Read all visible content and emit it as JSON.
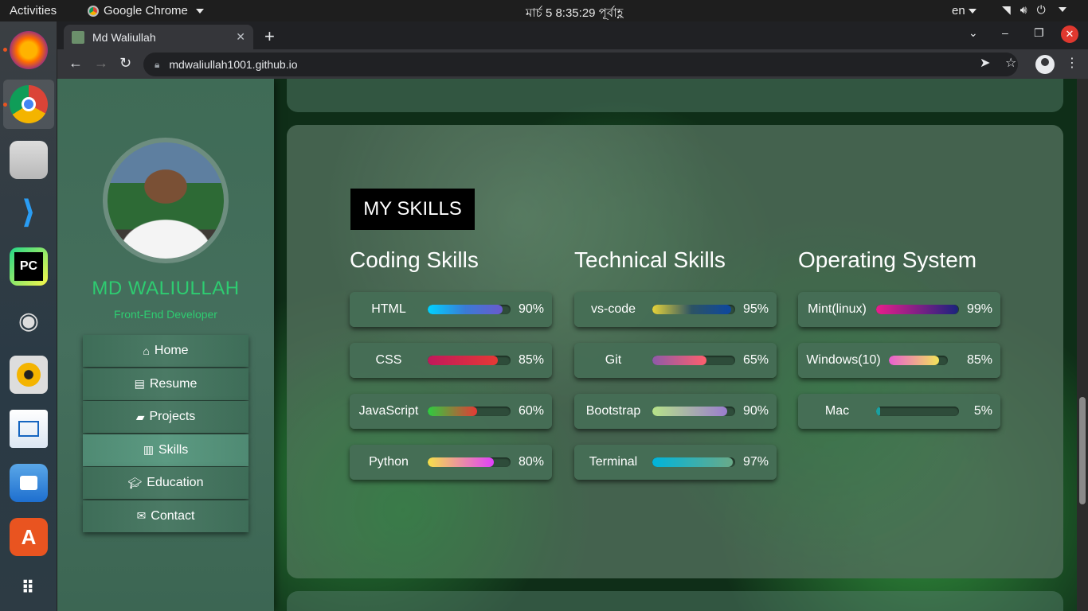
{
  "topbar": {
    "activities": "Activities",
    "app_name": "Google Chrome",
    "clock": "মার্চ 5  8:35:29 পূর্বাহ্ণ",
    "lang": "en"
  },
  "browser": {
    "tab_title": "Md Waliullah",
    "url": "mdwaliullah1001.github.io"
  },
  "sidebar": {
    "name": "MD WALIULLAH",
    "role": "Front-End Developer",
    "nav": [
      "Home",
      "Resume",
      "Projects",
      "Skills",
      "Education",
      "Contact"
    ],
    "active": "Skills"
  },
  "skills": {
    "heading": "MY SKILLS",
    "columns": [
      {
        "title": "Coding Skills",
        "items": [
          {
            "name": "HTML",
            "label": "90%",
            "value": 0.9,
            "gradient": "linear-gradient(90deg,#00d2ff,#3a7bd5,#6a5acd)"
          },
          {
            "name": "CSS",
            "label": "85%",
            "value": 0.85,
            "gradient": "linear-gradient(90deg,#c2185b,#e53935)"
          },
          {
            "name": "JavaScript",
            "label": "60%",
            "value": 0.6,
            "gradient": "linear-gradient(90deg,#2ecc40,#e53935)"
          },
          {
            "name": "Python",
            "label": "80%",
            "value": 0.8,
            "gradient": "linear-gradient(90deg,#f5e04a,#e040fb)"
          }
        ]
      },
      {
        "title": "Technical Skills",
        "items": [
          {
            "name": "vs-code",
            "label": "95%",
            "value": 0.95,
            "gradient": "linear-gradient(90deg,#e6d33a,#2c5364,#0d47a1)"
          },
          {
            "name": "Git",
            "label": "65%",
            "value": 0.65,
            "gradient": "linear-gradient(90deg,#8e5aa8,#ff5f6d)"
          },
          {
            "name": "Bootstrap",
            "label": "90%",
            "value": 0.9,
            "gradient": "linear-gradient(90deg,#b6e388,#9b7dcf)"
          },
          {
            "name": "Terminal",
            "label": "97%",
            "value": 0.97,
            "gradient": "linear-gradient(90deg,#00b4db,#6aaa88)"
          }
        ]
      },
      {
        "title": "Operating System",
        "items": [
          {
            "name": "Mint(linux)",
            "label": "99%",
            "value": 0.99,
            "gradient": "linear-gradient(90deg,#e91e8c,#1a237e)"
          },
          {
            "name": "Windows(10)",
            "label": "85%",
            "value": 0.85,
            "gradient": "linear-gradient(90deg,#e85fd0,#f3e35a)"
          },
          {
            "name": "Mac",
            "label": "5%",
            "value": 0.05,
            "gradient": "linear-gradient(90deg,#1aa0a0,#1aa0a0)"
          }
        ]
      }
    ]
  }
}
